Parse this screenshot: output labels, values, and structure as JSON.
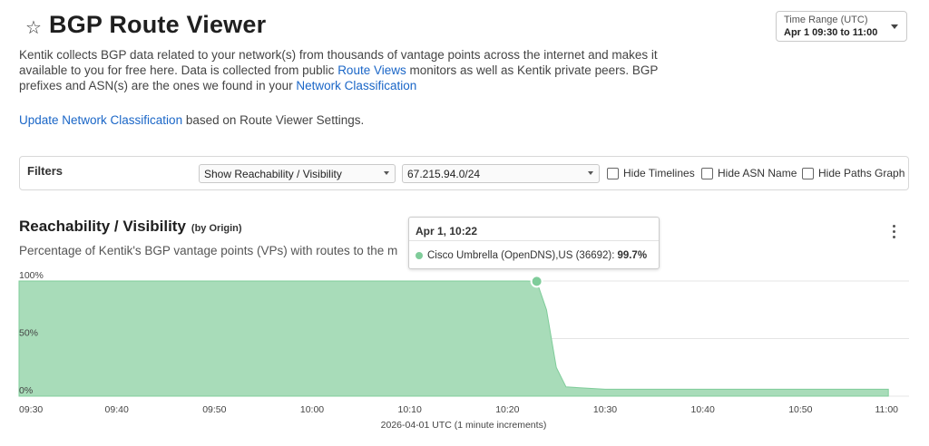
{
  "header": {
    "title": "BGP Route Viewer",
    "star_icon": "star-icon"
  },
  "time_range": {
    "label": "Time Range (UTC)",
    "value": "Apr 1 09:30 to 11:00"
  },
  "description": {
    "part1": "Kentik collects BGP data related to your network(s) from thousands of vantage points across the internet and makes it available to you for free here. Data is collected from public ",
    "link1": "Route Views",
    "part2": " monitors as well as Kentik private peers. BGP prefixes and ASN(s) are the ones we found in your ",
    "link2": "Network Classification"
  },
  "update": {
    "link": "Update Network Classification",
    "text": " based on Route Viewer Settings."
  },
  "filters": {
    "label": "Filters",
    "view_select": "Show Reachability / Visibility",
    "prefix_select": "67.215.94.0/24",
    "hide_timelines": "Hide Timelines",
    "hide_asn": "Hide ASN Name",
    "hide_paths": "Hide Paths Graph"
  },
  "section": {
    "title": "Reachability / Visibility",
    "subtitle": "(by Origin)",
    "description": "Percentage of Kentik's BGP vantage points (VPs) with routes to the m"
  },
  "tooltip": {
    "time": "Apr 1, 10:22",
    "series": "Cisco Umbrella (OpenDNS),US (36692):",
    "value": "99.7%"
  },
  "chart_data": {
    "type": "area",
    "xlabel": "2026-04-01 UTC (1 minute increments)",
    "x_ticks": [
      "09:30",
      "09:40",
      "09:50",
      "10:00",
      "10:10",
      "10:20",
      "10:30",
      "10:40",
      "10:50",
      "11:00"
    ],
    "y_ticks": [
      "100%",
      "50%",
      "0%"
    ],
    "ylim": [
      0,
      100
    ],
    "xlim_minutes": [
      0,
      90
    ],
    "series": [
      {
        "name": "Cisco Umbrella (OpenDNS),US (36692)",
        "color": "#a8dcb9",
        "points": [
          [
            0,
            100
          ],
          [
            52,
            100
          ],
          [
            53,
            99.7
          ],
          [
            54,
            75
          ],
          [
            55,
            25
          ],
          [
            56,
            8
          ],
          [
            58,
            7
          ],
          [
            60,
            6
          ],
          [
            89,
            6
          ]
        ]
      }
    ],
    "highlight_minute": 53,
    "grid": true
  },
  "colors": {
    "accent": "#1a66c7",
    "area": "#a8dcb9",
    "area_line": "#7fcc9a"
  }
}
